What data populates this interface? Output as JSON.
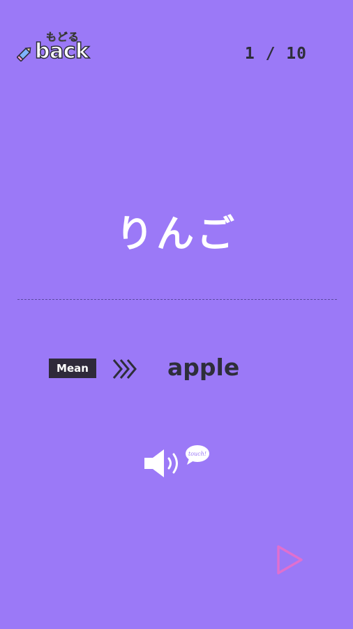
{
  "header": {
    "back_kana": "もどる",
    "back_word": "back",
    "counter": "1 / 10"
  },
  "card": {
    "word": "りんご",
    "mean_label": "Mean",
    "meaning": "apple"
  },
  "audio": {
    "touch_label": "touch!"
  },
  "colors": {
    "background": "#9b79f7",
    "dark_text": "#2e2e3a",
    "next_arrow": "#e06fcf"
  },
  "icons": {
    "back": "pencil-icon",
    "arrow": "chevrons-right-icon",
    "sound": "speaker-icon",
    "next": "play-triangle-icon"
  }
}
